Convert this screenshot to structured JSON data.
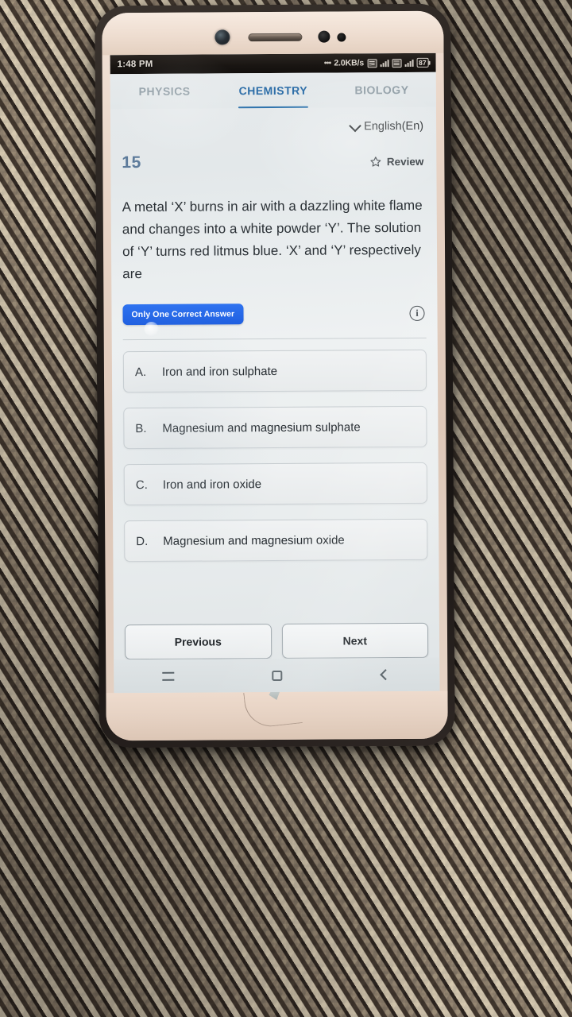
{
  "status_bar": {
    "clock": "1:48 PM",
    "network_dots": "•••",
    "network_speed": "2.0KB/s",
    "sim_icon": "sim-card-icon",
    "signal_icon": "signal-bars-icon",
    "sim2_icon": "sim-card-2-icon",
    "signal2_icon": "signal-bars-2-icon",
    "battery_level": "87"
  },
  "tabs": [
    {
      "label": "PHYSICS",
      "active": false
    },
    {
      "label": "CHEMISTRY",
      "active": true
    },
    {
      "label": "BIOLOGY",
      "active": false
    }
  ],
  "language": {
    "selected": "English(En)",
    "chevron_icon": "chevron-down-icon"
  },
  "question": {
    "number": "15",
    "review_label": "Review",
    "review_icon": "star-outline-icon",
    "text": "A metal ‘X’ burns in air with a dazzling white flame and changes into a white powder ‘Y’. The solution of ‘Y’ turns red litmus blue. ‘X’ and ‘Y’ respectively are",
    "badge": "Only One Correct Answer",
    "info_icon": "info-circle-icon",
    "info_glyph": "i"
  },
  "options": [
    {
      "letter": "A.",
      "text": "Iron and iron sulphate"
    },
    {
      "letter": "B.",
      "text": "Magnesium and magnesium sulphate"
    },
    {
      "letter": "C.",
      "text": "Iron and iron oxide"
    },
    {
      "letter": "D.",
      "text": "Magnesium and magnesium oxide"
    }
  ],
  "nav_buttons": {
    "previous": "Previous",
    "next": "Next"
  },
  "android_navbar": {
    "recents_icon": "recents-icon",
    "home_icon": "home-square-icon",
    "back_icon": "back-chevron-icon"
  },
  "colors": {
    "accent_blue": "#2f74ad",
    "badge_blue": "#2f73f0",
    "question_number": "#5d7b9b",
    "inactive_tab": "#93a0a8",
    "screen_bg": "#e9edee"
  }
}
